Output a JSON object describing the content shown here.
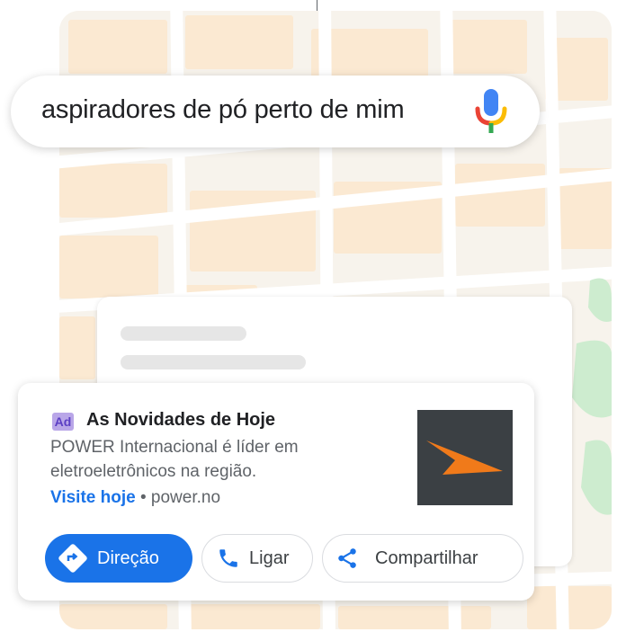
{
  "search": {
    "query": "aspiradores de pó perto de mim"
  },
  "ad": {
    "badge": "Ad",
    "title": "As Novidades de Hoje",
    "description": "POWER Internacional é líder em eletroeletrônicos na região.",
    "link_label": "Visite hoje",
    "separator": " • ",
    "domain": "power.no"
  },
  "actions": {
    "directions_label": "Direção",
    "call_label": "Ligar",
    "share_label": "Compartilhar"
  },
  "icons": {
    "mic": "microphone-icon",
    "directions": "directions-icon",
    "call": "phone-icon",
    "share": "share-icon"
  },
  "colors": {
    "primary": "#1a73e8",
    "map_block": "#fae6cc",
    "map_road": "#ffffff",
    "park": "#cdeccf",
    "logo_bg": "#3b4044",
    "logo_accent": "#f07a1a"
  }
}
